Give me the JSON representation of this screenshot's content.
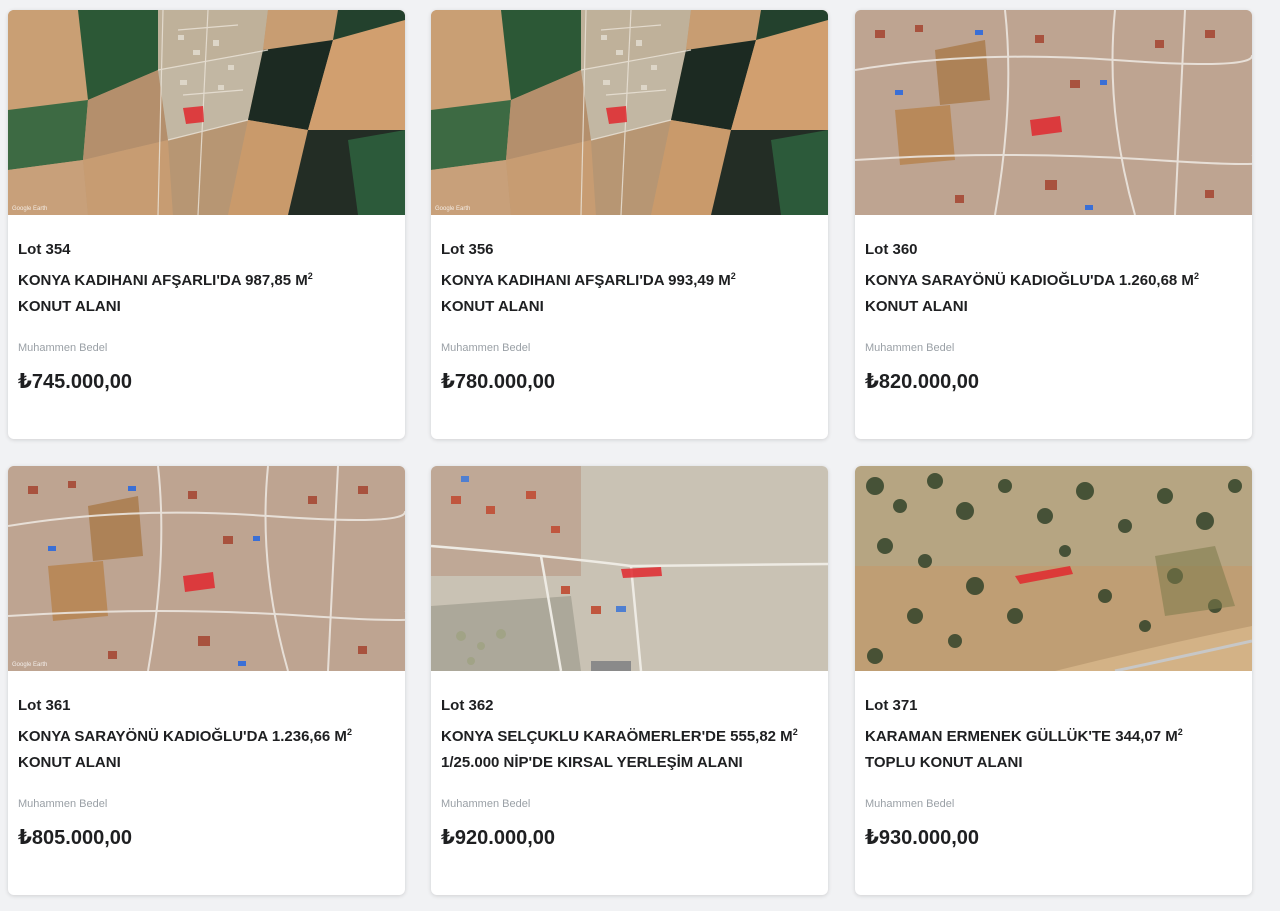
{
  "listings": [
    {
      "lot": "Lot 354",
      "title": "KONYA KADIHANI AFŞARLI'DA 987,85 M",
      "sup": "2",
      "subtitle": "KONUT ALANI",
      "price_label": "Muhammen Bedel",
      "price": "₺745.000,00",
      "image": "aerial-farmland",
      "image_credit": "Google Earth"
    },
    {
      "lot": "Lot 356",
      "title": "KONYA KADIHANI AFŞARLI'DA 993,49 M",
      "sup": "2",
      "subtitle": "KONUT ALANI",
      "price_label": "Muhammen Bedel",
      "price": "₺780.000,00",
      "image": "aerial-farmland",
      "image_credit": "Google Earth"
    },
    {
      "lot": "Lot 360",
      "title": "KONYA SARAYÖNÜ KADIOĞLU'DA 1.260,68 M",
      "sup": "2",
      "subtitle": "KONUT ALANI",
      "price_label": "Muhammen Bedel",
      "price": "₺820.000,00",
      "image": "aerial-village",
      "image_credit": ""
    },
    {
      "lot": "Lot 361",
      "title": "KONYA SARAYÖNÜ KADIOĞLU'DA 1.236,66 M",
      "sup": "2",
      "subtitle": "KONUT ALANI",
      "price_label": "Muhammen Bedel",
      "price": "₺805.000,00",
      "image": "aerial-village",
      "image_credit": "Google Earth"
    },
    {
      "lot": "Lot 362",
      "title": "KONYA SELÇUKLU KARAÖMERLER'DE 555,82 M",
      "sup": "2",
      "subtitle": "1/25.000 NİP'DE KIRSAL YERLEŞİM ALANI",
      "price_label": "Muhammen Bedel",
      "price": "₺920.000,00",
      "image": "aerial-outskirts",
      "image_credit": ""
    },
    {
      "lot": "Lot 371",
      "title": "KARAMAN ERMENEK GÜLLÜK'TE 344,07 M",
      "sup": "2",
      "subtitle": "TOPLU KONUT ALANI",
      "price_label": "Muhammen Bedel",
      "price": "₺930.000,00",
      "image": "aerial-scrubland",
      "image_credit": ""
    }
  ],
  "colors": {
    "page_bg": "#f1f2f4",
    "card_bg": "#ffffff",
    "text": "#1e1f21",
    "muted": "#9aa0a6",
    "parcel_highlight": "#e0282e"
  }
}
